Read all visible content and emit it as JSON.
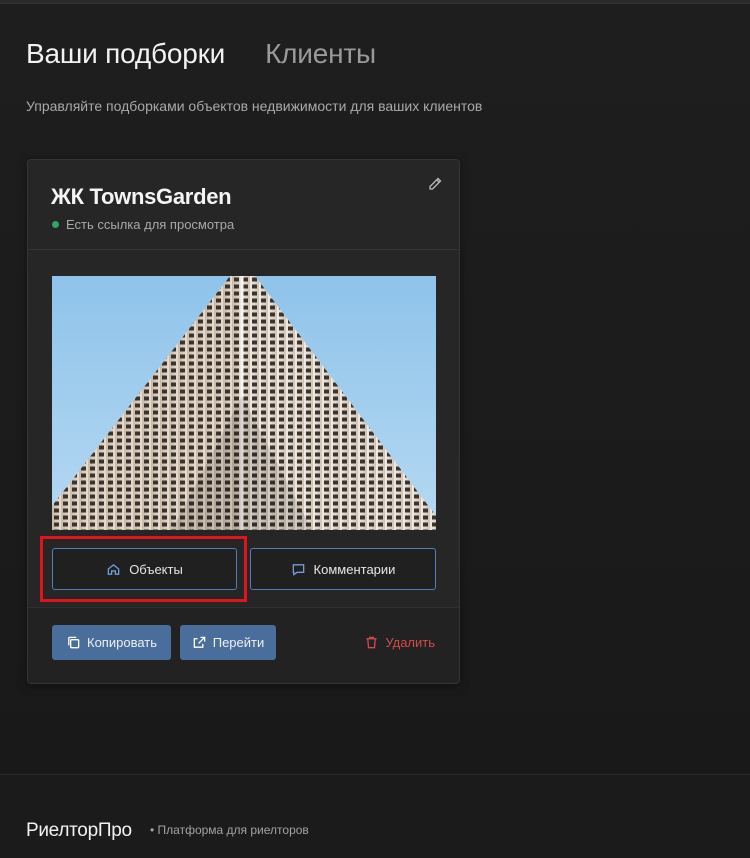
{
  "header": {
    "tabs": [
      {
        "label": "Ваши подборки",
        "active": true
      },
      {
        "label": "Клиенты",
        "active": false
      }
    ],
    "subtitle": "Управляйте подборками объектов недвижимости для ваших клиентов"
  },
  "card": {
    "title": "ЖК TownsGarden",
    "status_text": "Есть ссылка для просмотра",
    "status_color": "#2ea46a",
    "edit_icon": "pencil-icon",
    "image_subject": "high-rise building facade",
    "buttons": {
      "objects": "Объекты",
      "comments": "Комментарии",
      "copy": "Копировать",
      "go": "Перейти",
      "delete": "Удалить"
    }
  },
  "footer": {
    "brand": "РиелторПро",
    "tagline": "• Платформа для риелторов"
  },
  "colors": {
    "accent": "#4a6e9c",
    "outline": "#4f7fb5",
    "danger": "#d24a4a",
    "highlight": "#e0141c"
  }
}
